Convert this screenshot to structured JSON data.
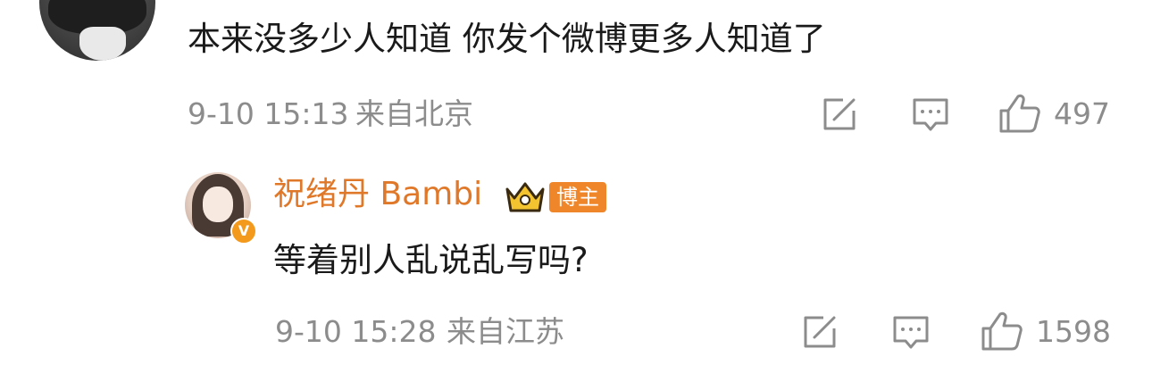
{
  "comment": {
    "text": "本来没多少人知道 你发个微博更多人知道了",
    "date": "9-10 15:13",
    "location": "来自北京",
    "likes": "497"
  },
  "reply": {
    "username": "祝绪丹 Bambi",
    "author_badge": "博主",
    "verified_badge": "V",
    "text": "等着别人乱说乱写吗?",
    "date": "9-10 15:28",
    "location": "来自江苏",
    "likes": "1598"
  },
  "colors": {
    "username": "#e0782a",
    "meta": "#8c8c8c",
    "badge": "#f0862a"
  },
  "icons": [
    "share-icon",
    "comment-icon",
    "like-icon",
    "crown-icon"
  ]
}
